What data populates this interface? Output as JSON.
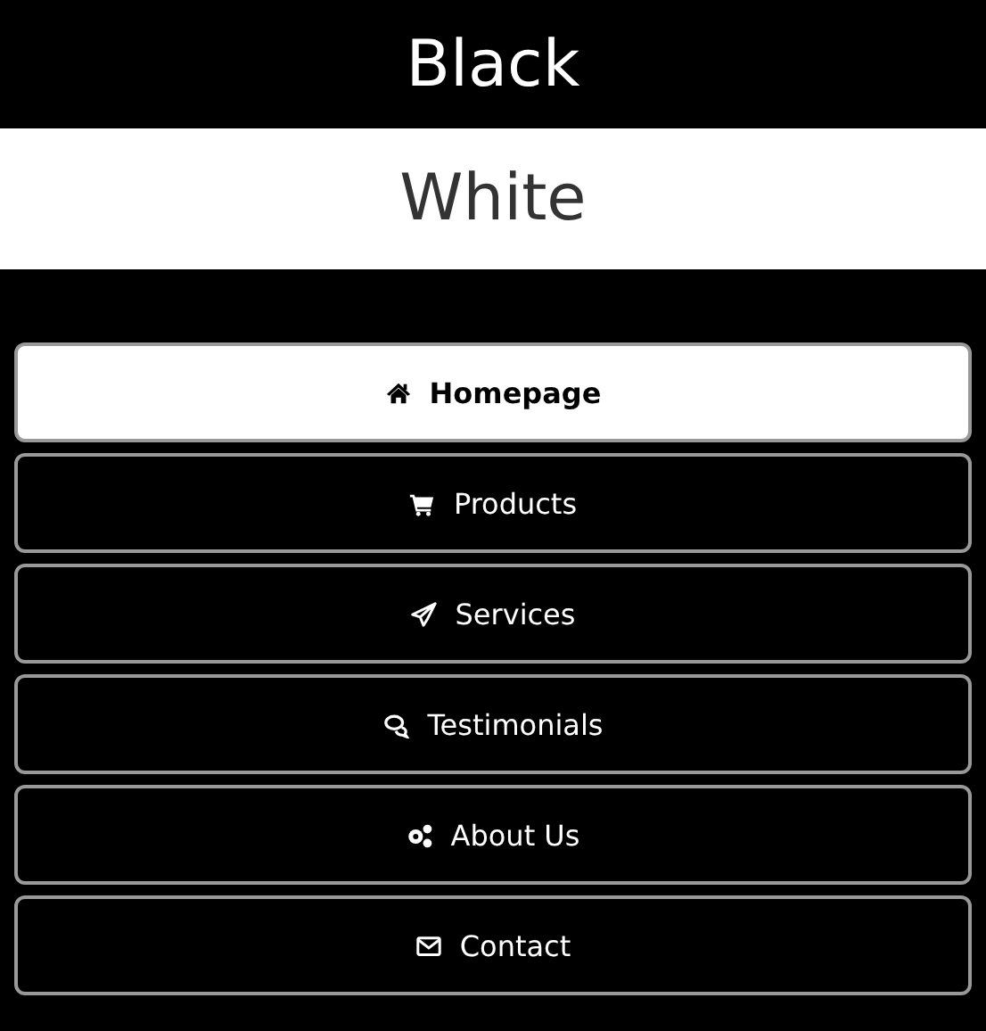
{
  "header": {
    "title": "Black"
  },
  "banner": {
    "title": "White"
  },
  "menu": [
    {
      "label": "Homepage",
      "selected": true
    },
    {
      "label": "Products",
      "selected": false
    },
    {
      "label": "Services",
      "selected": false
    },
    {
      "label": "Testimonials",
      "selected": false
    },
    {
      "label": "About Us",
      "selected": false
    },
    {
      "label": "Contact",
      "selected": false
    }
  ]
}
